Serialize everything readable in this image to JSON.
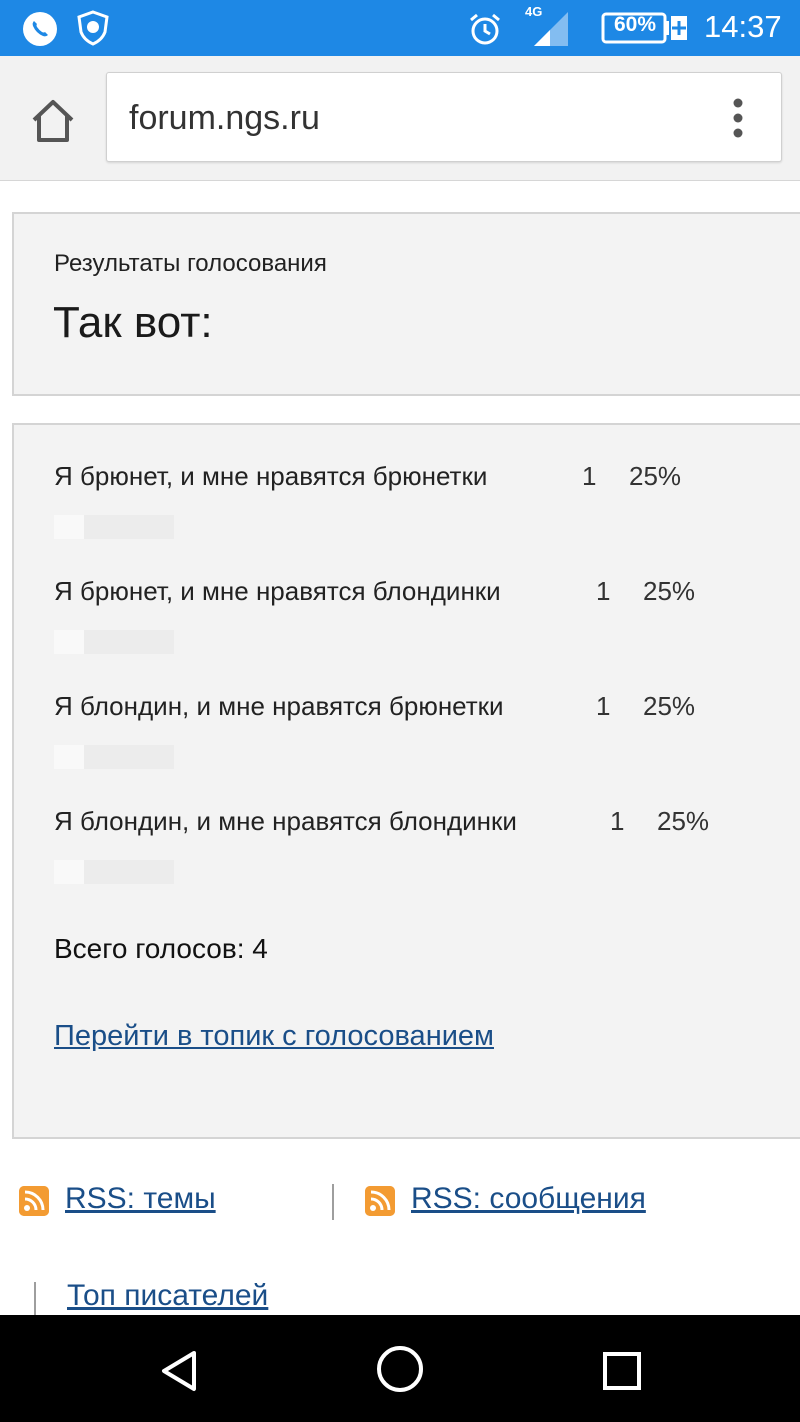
{
  "status_bar": {
    "network": "4G",
    "battery": "60%",
    "time": "14:37",
    "icons": [
      "phone-icon",
      "shield-icon",
      "alarm-icon",
      "signal-icon",
      "battery-icon"
    ]
  },
  "browser": {
    "url": "forum.ngs.ru",
    "icons": [
      "home-icon",
      "menu-icon"
    ]
  },
  "poll": {
    "header_label": "Результаты голосования",
    "title": "Так вот:",
    "options": [
      {
        "label": "Я брюнет, и мне нравятся брюнетки",
        "count": "1",
        "percent": "25%",
        "fraction": 0.25
      },
      {
        "label": "Я брюнет, и мне нравятся блондинки",
        "count": "1",
        "percent": "25%",
        "fraction": 0.25
      },
      {
        "label": "Я блондин, и мне нравятся брюнетки",
        "count": "1",
        "percent": "25%",
        "fraction": 0.25
      },
      {
        "label": "Я блондин, и мне нравятся блондинки",
        "count": "1",
        "percent": "25%",
        "fraction": 0.25
      }
    ],
    "total_votes": "Всего голосов: 4",
    "topic_link": "Перейти в топик с голосованием"
  },
  "footer": {
    "rss_topics": "RSS: темы",
    "rss_messages": "RSS: сообщения",
    "top_writers": "Топ писателей"
  },
  "colors": {
    "status_bar": "#1e88e5",
    "link": "#1a4e88",
    "rss": "#f39b32",
    "panel_bg": "#f3f3f3"
  }
}
